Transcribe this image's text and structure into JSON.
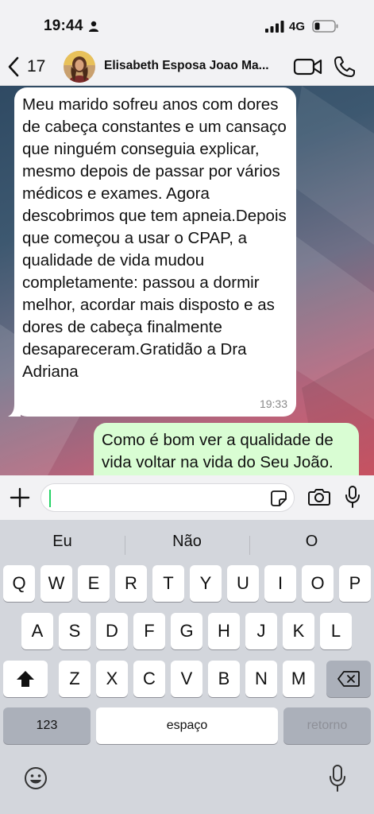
{
  "status_bar": {
    "time": "19:44",
    "network": "4G"
  },
  "header": {
    "back_count": "17",
    "contact_name": "Elisabeth Esposa Joao Ma..."
  },
  "messages": [
    {
      "direction": "incoming",
      "text": "Meu marido sofreu anos com dores de cabeça constantes e um cansaço que ninguém conseguia explicar, mesmo depois de passar por vários médicos e exames. Agora descobrimos que tem apneia.Depois que começou a usar o CPAP, a qualidade de vida mudou completamente: passou a dormir melhor, acordar mais disposto e as dores de cabeça finalmente desapareceram.Gratidão a Dra Adriana",
      "time": "19:33"
    },
    {
      "direction": "outgoing",
      "text": "Como é bom ver a qualidade de vida voltar na vida do Seu João."
    }
  ],
  "input": {
    "value": ""
  },
  "keyboard": {
    "suggestions": [
      "Eu",
      "Não",
      "O"
    ],
    "row1": [
      "Q",
      "W",
      "E",
      "R",
      "T",
      "Y",
      "U",
      "I",
      "O",
      "P"
    ],
    "row2": [
      "A",
      "S",
      "D",
      "F",
      "G",
      "H",
      "J",
      "K",
      "L"
    ],
    "row3": [
      "Z",
      "X",
      "C",
      "V",
      "B",
      "N",
      "M"
    ],
    "numbers_label": "123",
    "space_label": "espaço",
    "return_label": "retorno"
  },
  "colors": {
    "incoming_bubble": "#ffffff",
    "outgoing_bubble": "#d9fdd3",
    "accent": "#25d366"
  },
  "icons": [
    "person-icon",
    "signal-icon",
    "battery-icon",
    "back-chevron-icon",
    "video-call-icon",
    "phone-icon",
    "plus-icon",
    "sticker-icon",
    "camera-icon",
    "microphone-icon",
    "shift-icon",
    "delete-icon",
    "emoji-icon",
    "dictation-icon"
  ]
}
